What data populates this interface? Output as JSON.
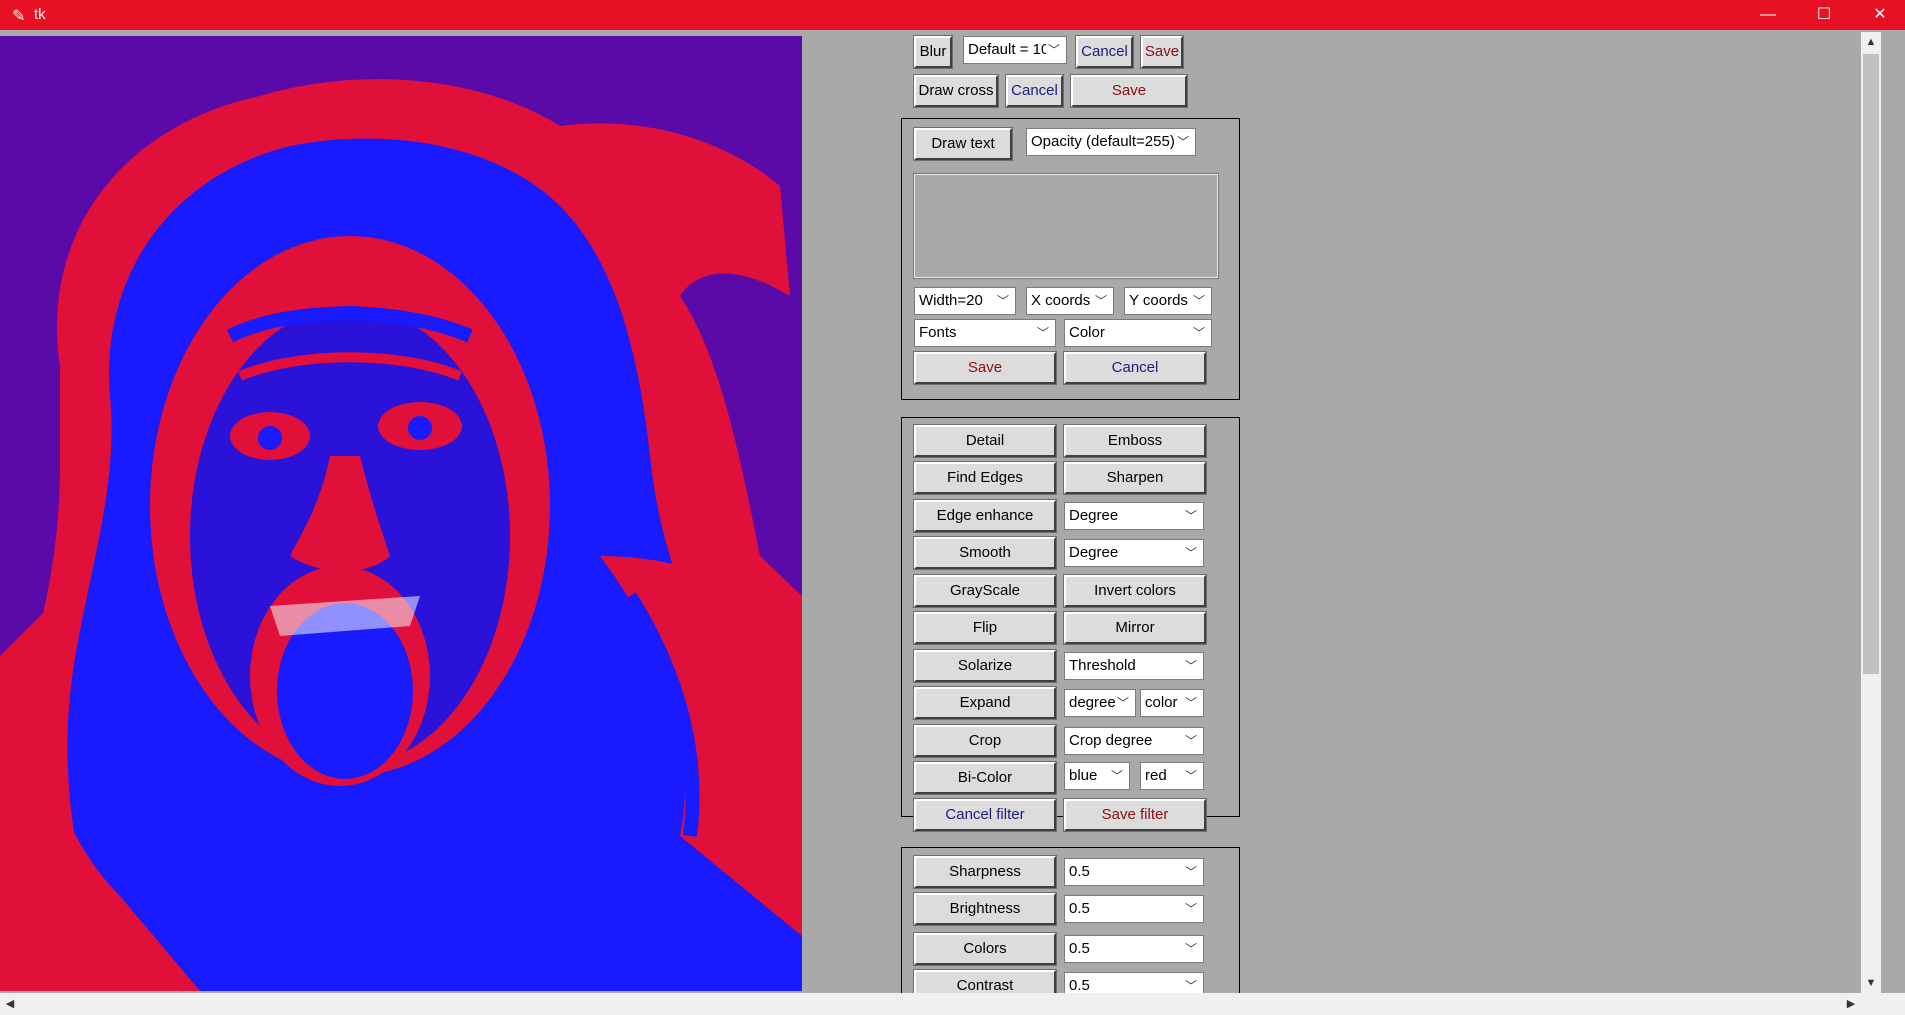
{
  "window": {
    "title": "tk",
    "controls": {
      "minimize": "—",
      "maximize": "☐",
      "close": "✕"
    }
  },
  "blur_row": {
    "button": "Blur",
    "combo": "Default = 10",
    "cancel": "Cancel",
    "save": "Save"
  },
  "cross_row": {
    "button": "Draw cross",
    "cancel": "Cancel",
    "save": "Save"
  },
  "text_panel": {
    "draw_text": "Draw text",
    "opacity": "Opacity (default=255)",
    "width": "Width=20",
    "x_coords": "X coords",
    "y_coords": "Y coords",
    "fonts": "Fonts",
    "color": "Color",
    "save": "Save",
    "cancel": "Cancel"
  },
  "filters": {
    "detail": "Detail",
    "emboss": "Emboss",
    "find_edges": "Find Edges",
    "sharpen": "Sharpen",
    "edge_enhance": "Edge enhance",
    "edge_degree": "Degree",
    "smooth": "Smooth",
    "smooth_degree": "Degree",
    "grayscale": "GrayScale",
    "invert": "Invert colors",
    "flip": "Flip",
    "mirror": "Mirror",
    "solarize": "Solarize",
    "threshold": "Threshold",
    "expand": "Expand",
    "expand_degree": "degree",
    "expand_color": "color",
    "crop": "Crop",
    "crop_degree": "Crop degree",
    "bicolor": "Bi-Color",
    "bicolor_1": "blue",
    "bicolor_2": "red",
    "cancel_filter": "Cancel filter",
    "save_filter": "Save filter"
  },
  "enhance": {
    "sharpness": "Sharpness",
    "sharpness_val": "0.5",
    "brightness": "Brightness",
    "brightness_val": "0.5",
    "colors": "Colors",
    "colors_val": "0.5",
    "contrast": "Contrast",
    "contrast_val": "0.5"
  },
  "colors": {
    "titlebar": "#e81123",
    "background": "#a9a9a9",
    "image_bg": "#5a0aa8",
    "image_blue": "#1a1aff",
    "image_red": "#e0103a"
  }
}
